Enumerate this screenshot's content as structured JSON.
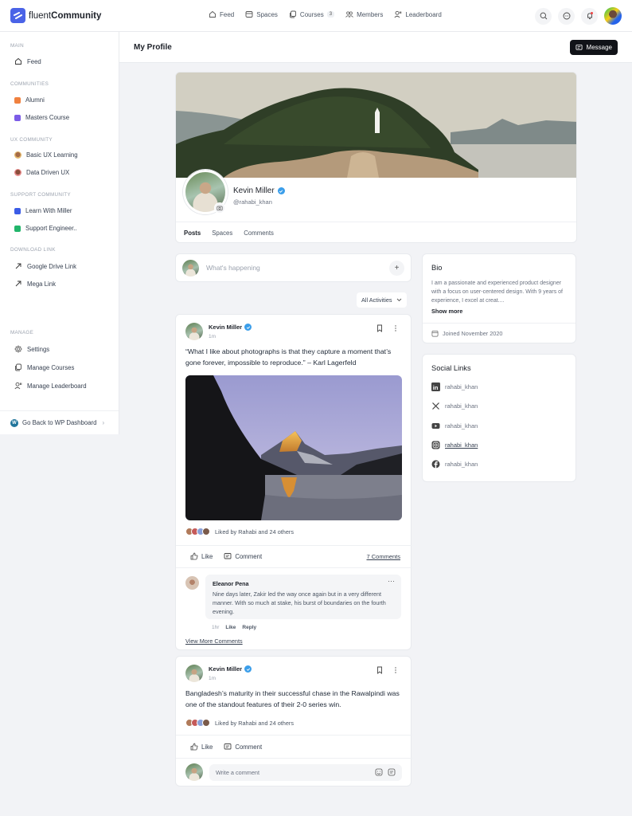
{
  "app": {
    "brand_light": "fluent",
    "brand_bold": "Community",
    "accent": "#4a63e7"
  },
  "nav": [
    {
      "label": "Feed",
      "icon": "home-icon"
    },
    {
      "label": "Spaces",
      "icon": "spaces-icon"
    },
    {
      "label": "Courses",
      "icon": "courses-icon",
      "badge": "3"
    },
    {
      "label": "Members",
      "icon": "members-icon"
    },
    {
      "label": "Leaderboard",
      "icon": "leaderboard-icon"
    }
  ],
  "top_actions": [
    "search-icon",
    "chat-icon",
    "bell-icon",
    "user-avatar"
  ],
  "sidebar": {
    "sections": [
      {
        "title": "MAIN",
        "items": [
          {
            "label": "Feed",
            "icon": "home-icon"
          }
        ]
      },
      {
        "title": "COMMUNITIES",
        "items": [
          {
            "label": "Alumni",
            "color": "#f0813f"
          },
          {
            "label": "Masters Course",
            "color": "#7c5ce7"
          }
        ]
      },
      {
        "title": "UX COMMUNITY",
        "items": [
          {
            "label": "Basic UX Learning",
            "icon": "avatar"
          },
          {
            "label": "Data Driven UX",
            "icon": "avatar"
          }
        ]
      },
      {
        "title": "SUPPORT COMMUNITY",
        "items": [
          {
            "label": "Learn With Miller",
            "color": "#3b5ce6"
          },
          {
            "label": "Support Engineer..",
            "color": "#22b56b"
          }
        ]
      },
      {
        "title": "DOWNLOAD LINK",
        "items": [
          {
            "label": "Google Drive Link",
            "icon": "arrow-up-right-icon"
          },
          {
            "label": "Mega Link",
            "icon": "arrow-up-right-icon"
          }
        ]
      },
      {
        "title": "MANAGE",
        "items": [
          {
            "label": "Settings",
            "icon": "gear-icon"
          },
          {
            "label": "Manage Courses",
            "icon": "courses-icon"
          },
          {
            "label": "Manage Leaderboard",
            "icon": "leaderboard-icon"
          }
        ]
      }
    ],
    "footer": "Go Back to WP Dashboard"
  },
  "page": {
    "title": "My Profile",
    "message_button": "Message"
  },
  "profile": {
    "name": "Kevin Miller",
    "handle": "@rahabi_khan",
    "tabs": [
      "Posts",
      "Spaces",
      "Comments"
    ],
    "active_tab": "Posts"
  },
  "composer": {
    "placeholder": "What's happening"
  },
  "filter": {
    "selected": "All Activities"
  },
  "posts": [
    {
      "author": "Kevin Miller",
      "time": "1m",
      "text": "“What I like about photographs is that they capture a moment that’s gone forever, impossible to reproduce.” – Karl Lagerfeld",
      "has_image": true,
      "likes_text": "Liked by Rahabi and 24 others",
      "like_label": "Like",
      "comment_label": "Comment",
      "comments_count": "7 Comments",
      "comment": {
        "author": "Eleanor Pena",
        "text": "Nine days later, Zakir led the way once again but in a very different manner. With so much at stake, his burst of boundaries on the fourth evening.",
        "time": "1hr",
        "like": "Like",
        "reply": "Reply"
      },
      "view_more": "View More Comments"
    },
    {
      "author": "Kevin Miller",
      "time": "1m",
      "text": "Bangladesh’s maturity in their successful chase in the Rawalpindi was one of the standout features of their 2-0 series win.",
      "likes_text": "Liked by Rahabi and 24 others",
      "like_label": "Like",
      "comment_label": "Comment",
      "write_placeholder": "Write  a comment"
    }
  ],
  "bio": {
    "title": "Bio",
    "text": "I am a passionate and experienced product designer with a focus on user-centered design. With 9 years of experience, I excel at creat....",
    "show_more": "Show more",
    "joined": "Joined November 2020"
  },
  "social": {
    "title": "Social Links",
    "links": [
      {
        "network": "linkedin",
        "handle": "rahabi_khan"
      },
      {
        "network": "x",
        "handle": "rahabi_khan"
      },
      {
        "network": "youtube",
        "handle": "rahabi_khan"
      },
      {
        "network": "instagram",
        "handle": "rahabi_khan"
      },
      {
        "network": "facebook",
        "handle": "rahabi_khan"
      }
    ]
  }
}
